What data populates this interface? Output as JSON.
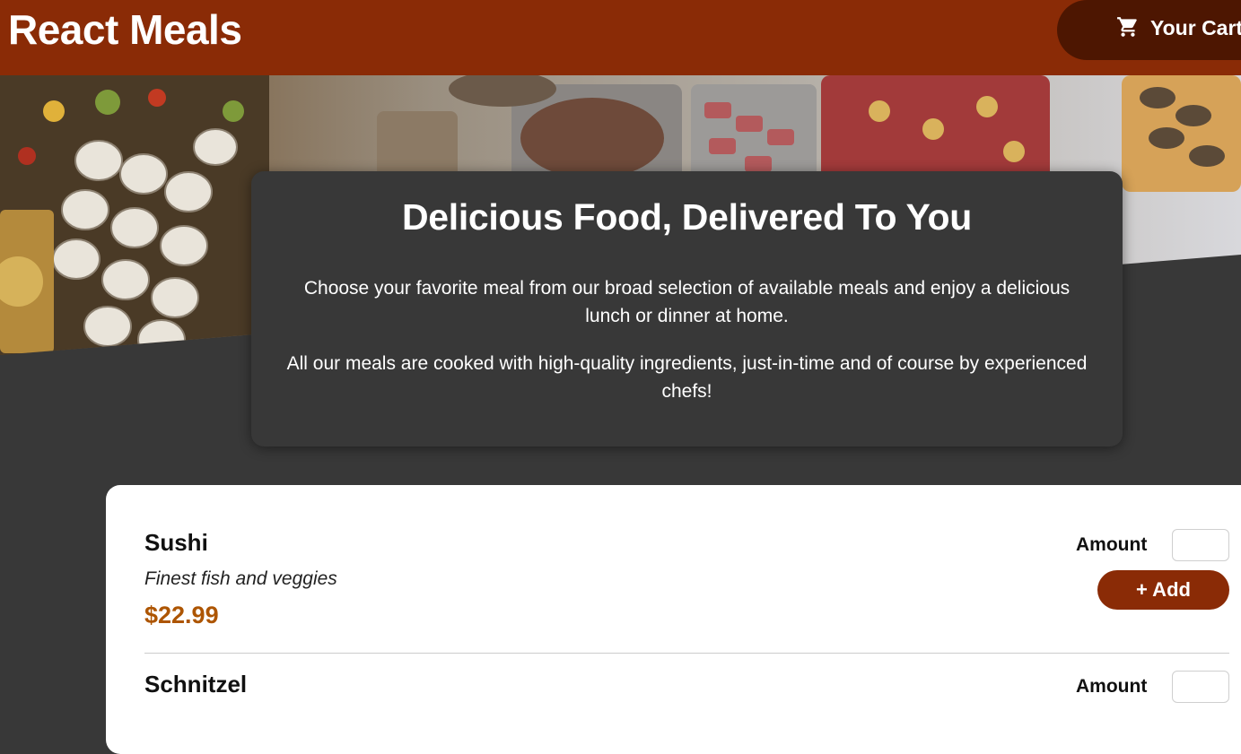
{
  "header": {
    "title": "React Meals",
    "cart_label": "Your Cart",
    "cart_icon": "shopping-cart-icon"
  },
  "summary": {
    "heading": "Delicious Food, Delivered To You",
    "paragraph_1": "Choose your favorite meal from our broad selection of available meals and enjoy a delicious lunch or dinner at home.",
    "paragraph_2": "All our meals are cooked with high-quality ingredients, just-in-time and of course by experienced chefs!"
  },
  "meals": [
    {
      "name": "Sushi",
      "description": "Finest fish and veggies",
      "price": "$22.99",
      "amount_label": "Amount",
      "amount_value": "",
      "add_label": "+ Add"
    },
    {
      "name": "Schnitzel",
      "amount_label": "Amount",
      "amount_value": ""
    }
  ],
  "colors": {
    "header_bg": "#8a2b06",
    "cart_bg": "#4d1601",
    "page_bg": "#383838",
    "price": "#ad5502"
  }
}
